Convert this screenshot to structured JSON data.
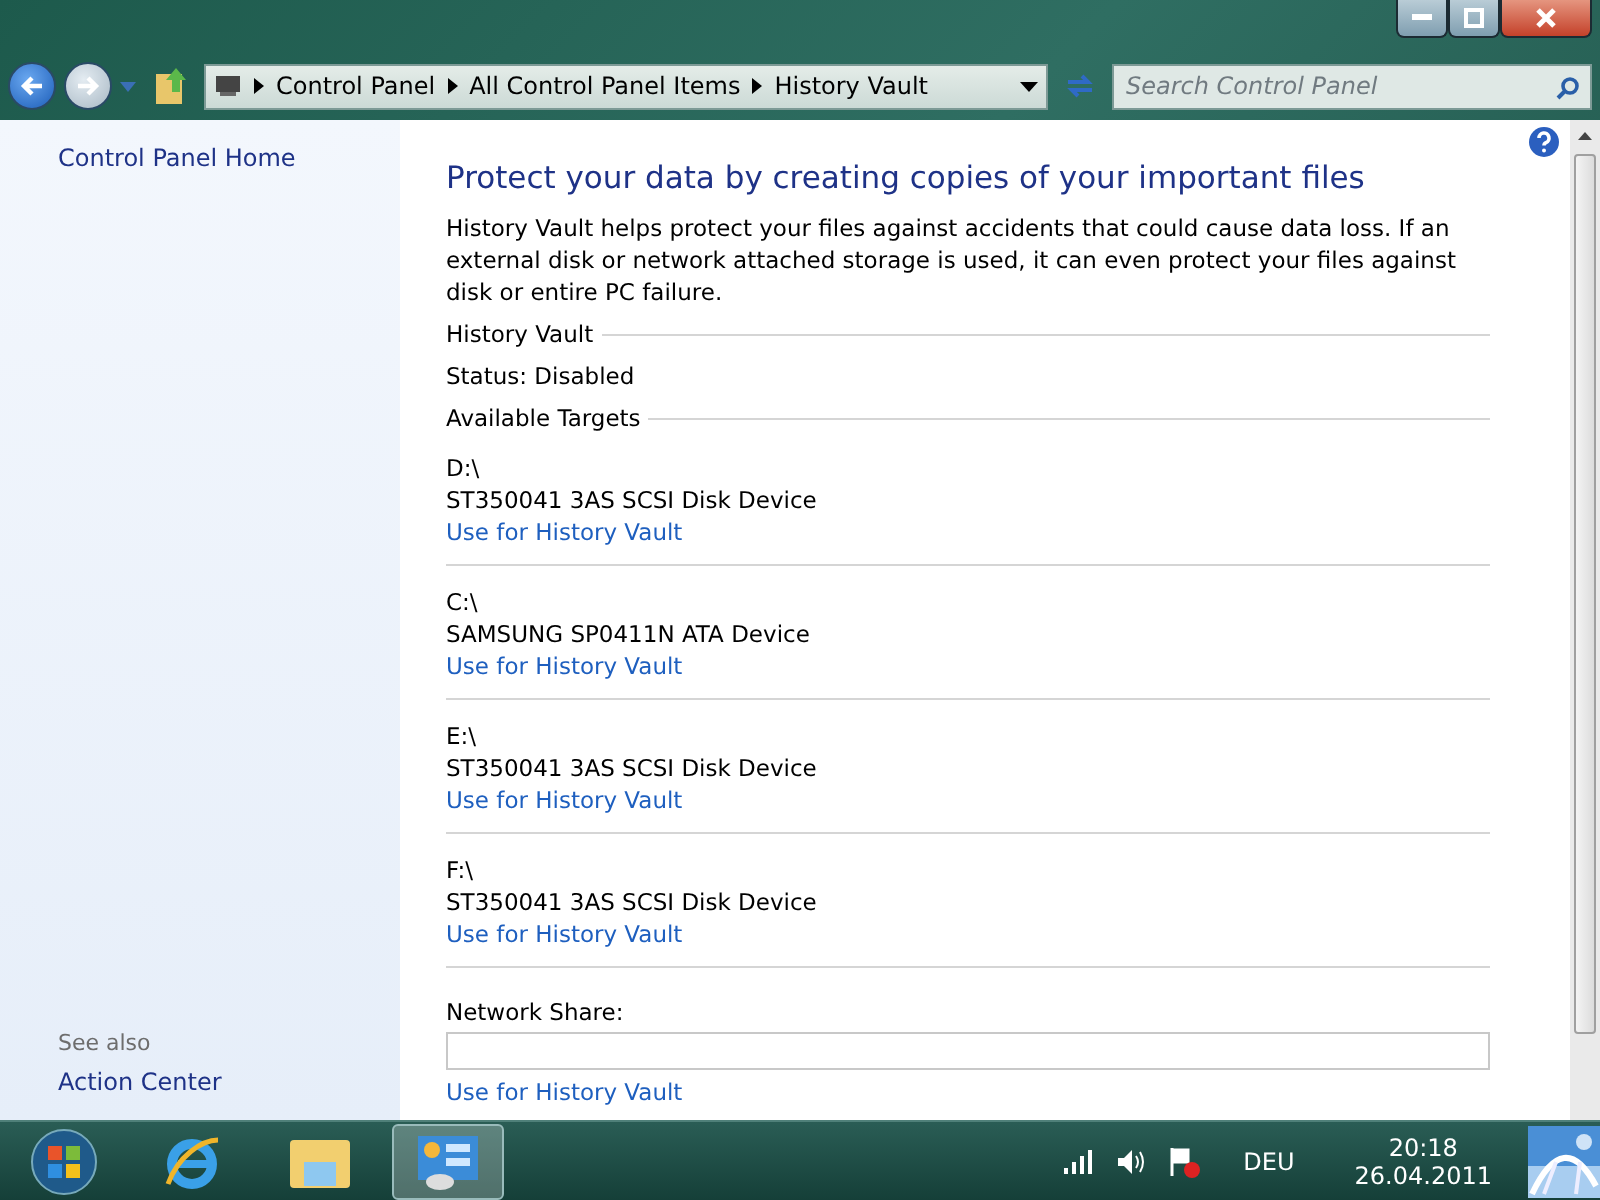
{
  "address_bar": {
    "crumbs": [
      "Control Panel",
      "All Control Panel Items",
      "History Vault"
    ]
  },
  "search": {
    "placeholder": "Search Control Panel"
  },
  "sidebar": {
    "home": "Control Panel Home",
    "see_also_title": "See also",
    "see_also": [
      "Action Center"
    ]
  },
  "content": {
    "heading": "Protect your data by creating copies of your important files",
    "intro": "History Vault helps protect your files against accidents that could cause data loss. If an external disk or network attached storage is used, it can even protect your files against disk or entire PC failure.",
    "section_vault": "History Vault",
    "status": "Status: Disabled",
    "section_targets": "Available Targets",
    "targets": [
      {
        "drive": "D:\\",
        "device": "ST350041 3AS SCSI Disk Device",
        "link": "Use for History Vault"
      },
      {
        "drive": "C:\\",
        "device": "SAMSUNG SP0411N ATA Device",
        "link": "Use for History Vault"
      },
      {
        "drive": "E:\\",
        "device": "ST350041 3AS SCSI Disk Device",
        "link": "Use for History Vault"
      },
      {
        "drive": "F:\\",
        "device": "ST350041 3AS SCSI Disk Device",
        "link": "Use for History Vault"
      }
    ],
    "network": {
      "label": "Network Share:",
      "link": "Use for History Vault"
    }
  },
  "taskbar": {
    "language": "DEU",
    "time": "20:18",
    "date": "26.04.2011"
  }
}
